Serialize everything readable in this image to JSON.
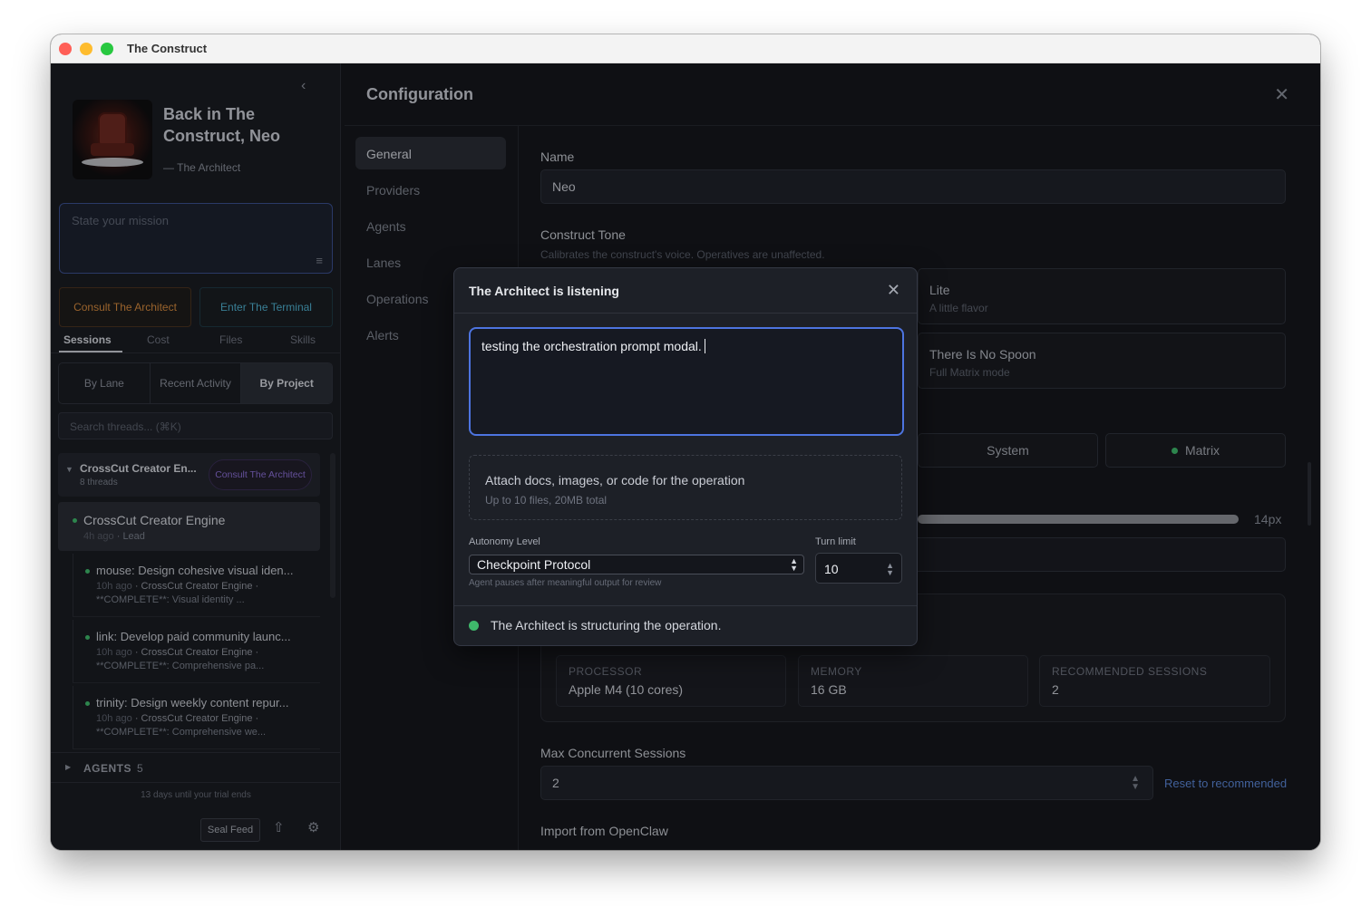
{
  "window": {
    "title": "The Construct"
  },
  "sidebar": {
    "hero_title": "Back in The Construct, Neo",
    "hero_sub": "— The Architect",
    "mission_placeholder": "State your mission",
    "consult_label": "Consult The Architect",
    "terminal_label": "Enter The Terminal",
    "tabs": [
      "Sessions",
      "Cost",
      "Files",
      "Skills"
    ],
    "group_by": [
      "By Lane",
      "Recent Activity",
      "By Project"
    ],
    "search_placeholder": "Search threads... (⌘K)",
    "project": {
      "name": "CrossCut Creator En...",
      "count": "8 threads",
      "consult_label": "Consult The Architect"
    },
    "lead_thread": {
      "title": "CrossCut Creator Engine",
      "ago": "4h ago",
      "role": "Lead"
    },
    "threads": [
      {
        "title": "mouse: Design cohesive visual iden...",
        "ago": "10h ago",
        "project": "CrossCut Creator Engine",
        "snippet": "**COMPLETE**: Visual identity ..."
      },
      {
        "title": "link: Develop paid community launc...",
        "ago": "10h ago",
        "project": "CrossCut Creator Engine",
        "snippet": "**COMPLETE**: Comprehensive pa..."
      },
      {
        "title": "trinity: Design weekly content repur...",
        "ago": "10h ago",
        "project": "CrossCut Creator Engine",
        "snippet": "**COMPLETE**: Comprehensive we..."
      }
    ],
    "agents_label": "AGENTS",
    "agents_count": "5",
    "trial_text": "13 days until your trial ends",
    "seal_feed_label": "Seal Feed"
  },
  "config": {
    "title": "Configuration",
    "nav": [
      "General",
      "Providers",
      "Agents",
      "Lanes",
      "Operations",
      "Alerts"
    ],
    "name_label": "Name",
    "name_value": "Neo",
    "tone_label": "Construct Tone",
    "tone_help": "Calibrates the construct's voice. Operatives are unaffected.",
    "tones": [
      {
        "name": "Lite",
        "desc": "A little flavor"
      },
      {
        "name": "There Is No Spoon",
        "desc": "Full Matrix mode"
      }
    ],
    "themes": [
      "System",
      "Matrix"
    ],
    "font_size": "14px",
    "hardware": [
      {
        "label": "PROCESSOR",
        "value": "Apple M4 (10 cores)"
      },
      {
        "label": "MEMORY",
        "value": "16 GB"
      },
      {
        "label": "RECOMMENDED SESSIONS",
        "value": "2"
      }
    ],
    "max_sessions_label": "Max Concurrent Sessions",
    "max_sessions_value": "2",
    "reset_label": "Reset to recommended",
    "import_label": "Import from OpenClaw"
  },
  "modal": {
    "title": "The Architect is listening",
    "prompt_text": "testing the orchestration prompt modal.",
    "attach_title": "Attach docs, images, or code for the operation",
    "attach_sub": "Up to 10 files, 20MB total",
    "autonomy_label": "Autonomy Level",
    "autonomy_value": "Checkpoint Protocol",
    "autonomy_help": "Agent pauses after meaningful output for review",
    "turn_label": "Turn limit",
    "turn_value": "10",
    "status_text": "The Architect is structuring the operation."
  },
  "colors": {
    "accent_blue": "#4d74e0",
    "status_green": "#3fb96b",
    "consult_orange": "#d58a3e",
    "terminal_cyan": "#4fb0cf"
  }
}
